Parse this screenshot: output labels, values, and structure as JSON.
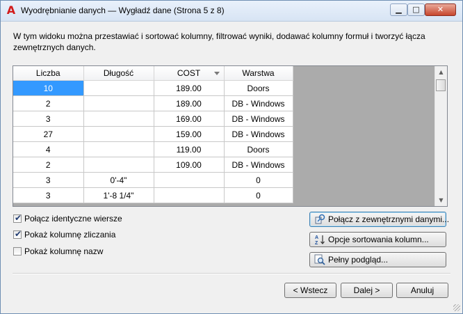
{
  "window": {
    "title": "Wyodrębnianie danych — Wygładź dane (Strona 5 z 8)",
    "app_icon_glyph": "A",
    "minimize_glyph": "▁",
    "maximize_glyph": "□",
    "close_glyph": "✕"
  },
  "description": "W tym widoku można przestawiać i sortować kolumny, filtrować wyniki, dodawać kolumny formuł i tworzyć łącza zewnętrznych danych.",
  "grid": {
    "columns": [
      "Liczba",
      "Długość",
      "COST",
      "Warstwa"
    ],
    "sorted_column": "COST",
    "rows": [
      [
        "10",
        "",
        "189.00",
        "Doors"
      ],
      [
        "2",
        "",
        "189.00",
        "DB - Windows"
      ],
      [
        "3",
        "",
        "169.00",
        "DB - Windows"
      ],
      [
        "27",
        "",
        "159.00",
        "DB - Windows"
      ],
      [
        "4",
        "",
        "119.00",
        "Doors"
      ],
      [
        "2",
        "",
        "109.00",
        "DB - Windows"
      ],
      [
        "3",
        "0'-4\"",
        "",
        "0"
      ],
      [
        "3",
        "1'-8 1/4\"",
        "",
        "0"
      ]
    ],
    "scroll_up_glyph": "▲",
    "scroll_down_glyph": "▼"
  },
  "options": {
    "combine_identical_rows": {
      "label": "Połącz identyczne wiersze",
      "checked": true
    },
    "show_count_column": {
      "label": "Pokaż kolumnę zliczania",
      "checked": true
    },
    "show_name_column": {
      "label": "Pokaż kolumnę nazw",
      "checked": false
    }
  },
  "actions": {
    "link_external": "Połącz z zewnętrznymi danymi...",
    "sort_options": "Opcje sortowania kolumn...",
    "full_preview": "Pełny podgląd..."
  },
  "footer": {
    "back": "< Wstecz",
    "next": "Dalej >",
    "cancel": "Anuluj"
  },
  "colors": {
    "selection": "#3399ff",
    "grid_empty": "#ababab",
    "app_icon": "#d21c1c"
  }
}
